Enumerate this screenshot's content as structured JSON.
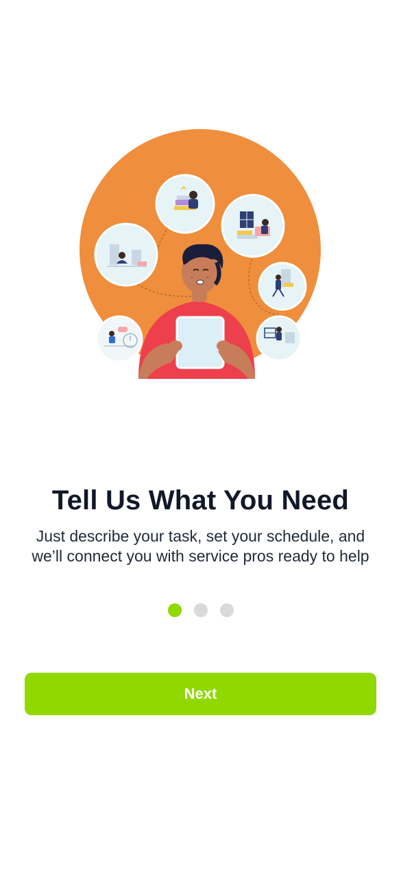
{
  "onboarding": {
    "illustration_icon": "person-with-tablet-and-task-bubbles-illustration",
    "title": "Tell Us What You Need",
    "description": "Just describe your task, set your schedule, and we’ll connect you with service pros ready to help",
    "pager": {
      "total": 3,
      "current": 1
    },
    "next_label": "Next"
  },
  "colors": {
    "accent": "#91d800",
    "illustration_circle": "#ef8e3c",
    "title": "#111827",
    "text": "#1f2937",
    "dot_inactive": "#d9d9d9"
  }
}
